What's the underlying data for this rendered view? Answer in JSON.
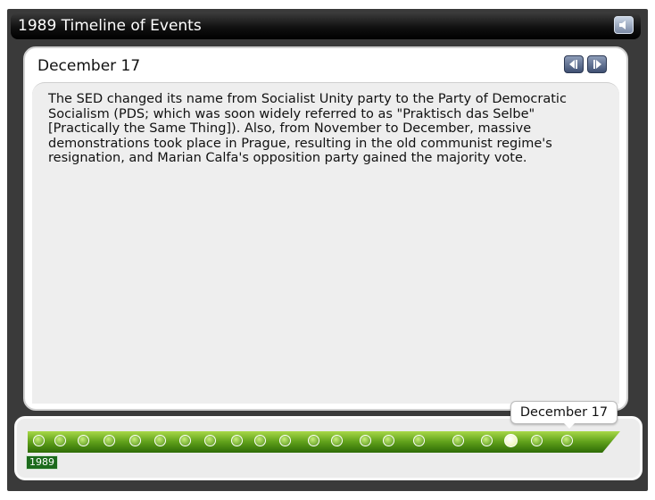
{
  "app": {
    "title": "1989 Timeline of Events"
  },
  "event": {
    "title": "December 17",
    "body": "The SED changed its name from Socialist Unity party to the Party of Democratic Socialism (PDS; which was soon widely referred to as \"Praktisch das Selbe\" [Practically the Same Thing]). Also, from November to December, massive demonstrations took place in Prague, resulting in the old communist regime's resignation, and Marian Calfa's opposition party gained the majority vote."
  },
  "timeline": {
    "year_label": "1989",
    "tooltip": "December 17",
    "event_count": 21,
    "active_index": 18
  },
  "icons": {
    "audio": "speaker-icon",
    "prev": "triangle-left-icon",
    "next": "triangle-right-icon"
  },
  "colors": {
    "track_green": "#5fa01a",
    "badge_green": "#1c6b1c",
    "nav_blue": "#3f5072"
  }
}
